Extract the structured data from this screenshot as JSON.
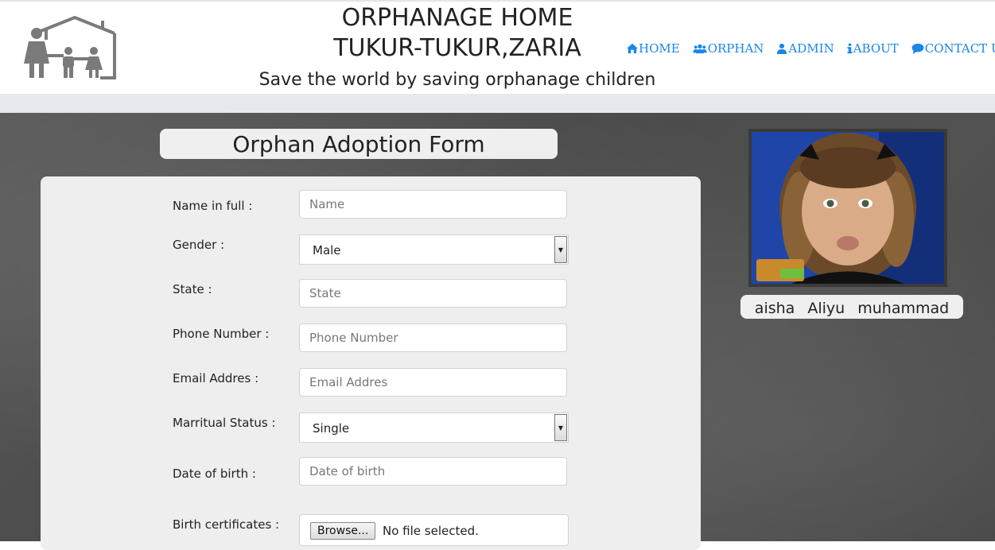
{
  "header": {
    "title_line1": "ORPHANAGE HOME",
    "title_line2": "TUKUR-TUKUR,ZARIA",
    "tagline": "Save the world by saving orphanage children",
    "logo_icon": "family-house-icon"
  },
  "nav": {
    "items": [
      {
        "label": "HOME",
        "icon": "home-icon"
      },
      {
        "label": "ORPHAN",
        "icon": "users-icon"
      },
      {
        "label": "ADMIN",
        "icon": "user-icon"
      },
      {
        "label": "ABOUT",
        "icon": "info-icon"
      },
      {
        "label": "CONTACT US",
        "icon": "comment-icon"
      }
    ]
  },
  "form": {
    "title": "Orphan Adoption Form",
    "fields": {
      "name": {
        "label": "Name in full :",
        "placeholder": "Name"
      },
      "gender": {
        "label": "Gender :",
        "value": "Male"
      },
      "state": {
        "label": "State :",
        "placeholder": "State"
      },
      "phone": {
        "label": "Phone Number :",
        "placeholder": "Phone Number"
      },
      "email": {
        "label": "Email Addres :",
        "placeholder": "Email Addres"
      },
      "marital": {
        "label": "Marritual Status :",
        "value": "Single"
      },
      "dob": {
        "label": "Date of birth :",
        "placeholder": "Date of birth"
      },
      "birth_cert": {
        "label": "Birth certificates :",
        "button": "Browse...",
        "status": "No file selected."
      }
    }
  },
  "orphan": {
    "name": "aisha Aliyu muhammad"
  },
  "colors": {
    "link": "#1a86e8",
    "background_dark": "#4f4f4f",
    "card": "#eeeeee"
  }
}
